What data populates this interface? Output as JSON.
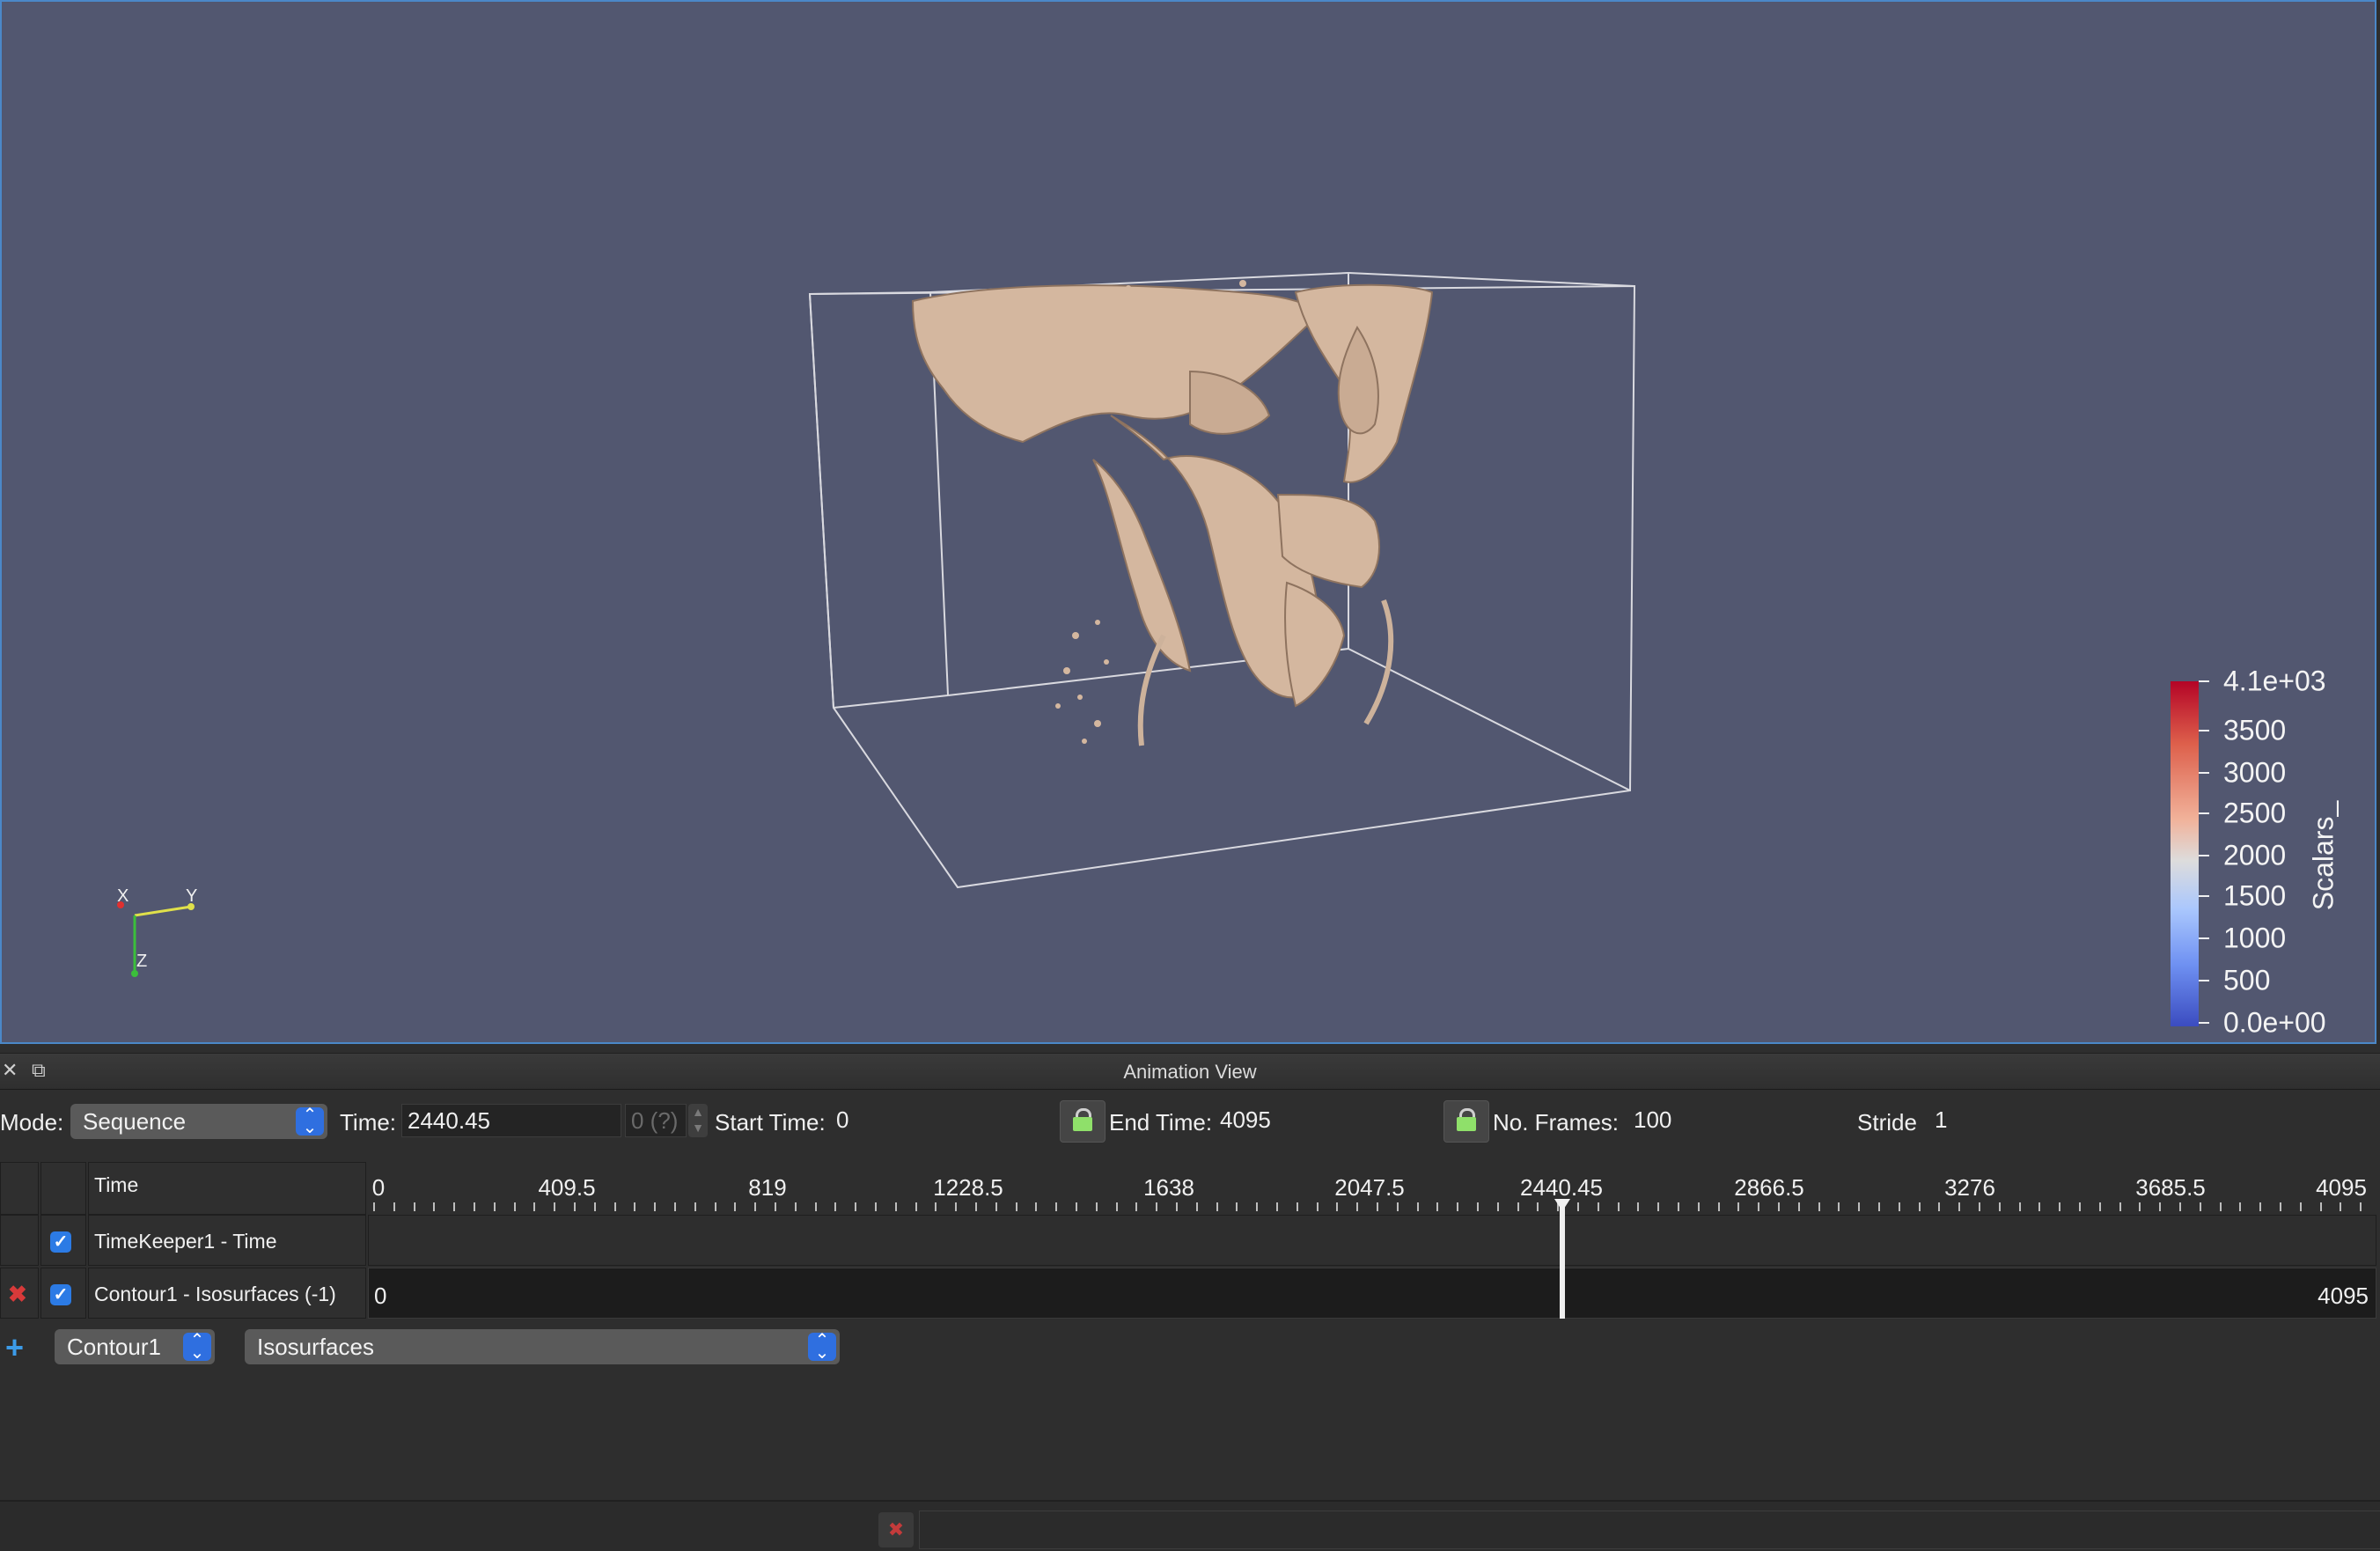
{
  "render_view": {
    "axes": {
      "x": "X",
      "y": "Y",
      "z": "Z"
    },
    "legend": {
      "title": "Scalars_",
      "labels": [
        "4.1e+03",
        "3500",
        "3000",
        "2500",
        "2000",
        "1500",
        "1000",
        "500",
        "0.0e+00"
      ]
    },
    "colors": {
      "background": "#525770",
      "surface": "#d4b79f",
      "border_active": "#4b88c8"
    }
  },
  "animation_view": {
    "title": "Animation View",
    "mode_label": "Mode:",
    "mode_value": "Sequence",
    "time_label": "Time:",
    "time_value": "2440.45",
    "time_index": "0 (?)",
    "start_time_label": "Start Time:",
    "start_time_value": "0",
    "end_time_label": "End Time:",
    "end_time_value": "4095",
    "frames_label": "No. Frames:",
    "frames_value": "100",
    "stride_label": "Stride",
    "stride_value": "1",
    "time_header": "Time",
    "ruler_labels": [
      "0",
      "409.5",
      "819",
      "1228.5",
      "1638",
      "2047.5",
      "2440.45",
      "2866.5",
      "3276",
      "3685.5",
      "4095"
    ],
    "tracks": [
      {
        "name": "TimeKeeper1 - Time",
        "checked": true
      },
      {
        "name": "Contour1 - Isosurfaces (-1)",
        "checked": true,
        "start": "0",
        "end": "4095"
      }
    ],
    "add_source": "Contour1",
    "add_property": "Isosurfaces"
  }
}
